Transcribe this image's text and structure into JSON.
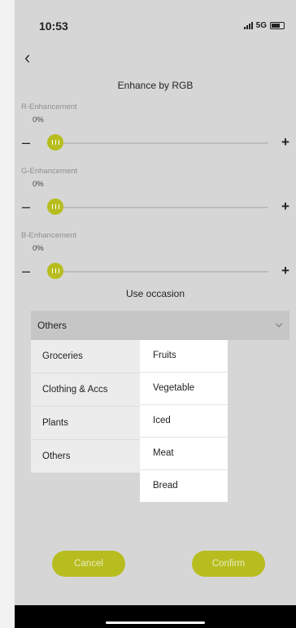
{
  "status_bar": {
    "time": "10:53",
    "network": "5G"
  },
  "header": {
    "back_glyph": "‹",
    "title": "Enhance by RGB"
  },
  "sliders": [
    {
      "label": "R-Enhancement",
      "value_text": "0%",
      "value": 0
    },
    {
      "label": "G-Enhancement",
      "value_text": "0%",
      "value": 0
    },
    {
      "label": "B-Enhancement",
      "value_text": "0%",
      "value": 0
    }
  ],
  "controls": {
    "minus": "–",
    "plus": "+"
  },
  "occasion": {
    "label": "Use occasion",
    "selected": "Others",
    "categories": [
      "Groceries",
      "Clothing & Accs",
      "Plants",
      "Others"
    ],
    "subcategories": [
      "Fruits",
      "Vegetable",
      "Iced",
      "Meat",
      "Bread"
    ]
  },
  "buttons": {
    "cancel": "Cancel",
    "confirm": "Confirm"
  },
  "colors": {
    "accent": "#b7bd1e",
    "background": "#d6d6d6",
    "panel": "#ececec"
  }
}
